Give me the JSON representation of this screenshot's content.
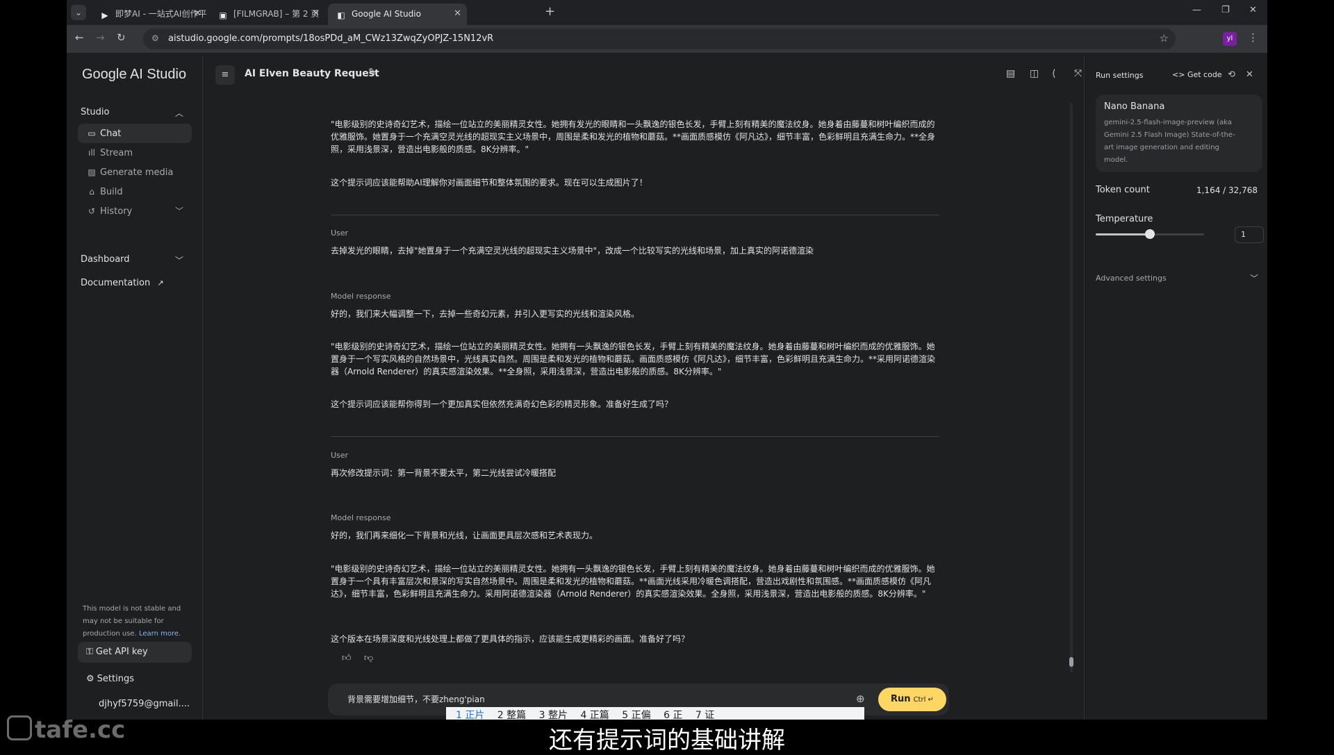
{
  "browser": {
    "tabs": [
      {
        "icon": "jimeng-icon",
        "title": "即梦AI - 一站式AI创作平台"
      },
      {
        "icon": "filmgrab-icon",
        "title": "[FILMGRAB] – 第 2 页"
      },
      {
        "icon": "ai-studio-icon",
        "title": "Google AI Studio"
      }
    ],
    "url": "aistudio.google.com/prompts/18osPDd_aM_CWz13ZwqZyOPJZ-15N12vR",
    "extension_badge": "yl"
  },
  "sidebar": {
    "brand": "Google AI Studio",
    "studio_label": "Studio",
    "items": [
      {
        "label": "Chat",
        "icon": "chat-icon"
      },
      {
        "label": "Stream",
        "icon": "stream-icon"
      },
      {
        "label": "Generate media",
        "icon": "media-icon"
      },
      {
        "label": "Build",
        "icon": "build-icon"
      },
      {
        "label": "History",
        "icon": "history-icon"
      }
    ],
    "dashboard_label": "Dashboard",
    "documentation_label": "Documentation",
    "note": "This model is not stable and may not be suitable for production use.",
    "note_link": "Learn more.",
    "get_api_key": "Get API key",
    "settings": "Settings",
    "account": "djhyf5759@gmail...."
  },
  "header": {
    "title": "AI Elven Beauty Request"
  },
  "chat": {
    "p1": "\"电影级别的史诗奇幻艺术，描绘一位站立的美丽精灵女性。她拥有发光的眼睛和一头飘逸的银色长发，手臂上刻有精美的魔法纹身。她身着由藤蔓和树叶编织而成的优雅服饰。她置身于一个充满空灵光线的超现实主义场景中，周围是柔和发光的植物和蘑菇。**画面质感模仿《阿凡达》，细节丰富，色彩鲜明且充满生命力。**全身照，采用浅景深，营造出电影般的质感。8K分辨率。\"",
    "p2": "这个提示词应该能帮助AI理解你对画面细节和整体氛围的要求。现在可以生成图片了！",
    "user_label": "User",
    "u1": "去掉发光的眼睛，去掉\"她置身于一个充满空灵光线的超现实主义场景中\"，改成一个比较写实的光线和场景，加上真实的阿诺德渲染",
    "model_label": "Model response",
    "m1a": "好的，我们来大幅调整一下，去掉一些奇幻元素，并引入更写实的光线和渲染风格。",
    "m1b": "\"电影级别的史诗奇幻艺术，描绘一位站立的美丽精灵女性。她拥有一头飘逸的银色长发，手臂上刻有精美的魔法纹身。她身着由藤蔓和树叶编织而成的优雅服饰。她置身于一个写实风格的自然场景中，光线真实自然。周围是柔和发光的植物和蘑菇。画面质感模仿《阿凡达》，细节丰富，色彩鲜明且充满生命力。**采用阿诺德渲染器（Arnold Renderer）的真实感渲染效果。**全身照，采用浅景深，营造出电影般的质感。8K分辨率。\"",
    "m1c": "这个提示词应该能帮你得到一个更加真实但依然充满奇幻色彩的精灵形象。准备好生成了吗？",
    "u2": "再次修改提示词：第一背景不要太平，第二光线尝试冷暖搭配",
    "m2a": "好的，我们再来细化一下背景和光线，让画面更具层次感和艺术表现力。",
    "m2b": "\"电影级别的史诗奇幻艺术，描绘一位站立的美丽精灵女性。她拥有一头飘逸的银色长发，手臂上刻有精美的魔法纹身。她身着由藤蔓和树叶编织而成的优雅服饰。她置身于一个具有丰富层次和景深的写实自然场景中。周围是柔和发光的植物和蘑菇。**画面光线采用冷暖色调搭配，营造出戏剧性和氛围感。**画面质感模仿《阿凡达》，细节丰富，色彩鲜明且充满生命力。采用阿诺德渲染器（Arnold Renderer）的真实感渲染效果。全身照，采用浅景深，营造出电影般的质感。8K分辨率。\"",
    "m2c": "这个版本在场景深度和光线处理上都做了更具体的指示，应该能生成更精彩的画面。准备好了吗？"
  },
  "composer": {
    "value": "背景需要增加细节，不要zheng'pian",
    "run_label": "Run",
    "run_shortcut": "Ctrl ↵",
    "ime_candidates": [
      "1 正片",
      "2 整篇",
      "3 整片",
      "4 正篇",
      "5 正偏",
      "6 正",
      "7 证"
    ]
  },
  "run_settings": {
    "title": "Run settings",
    "get_code": "Get code",
    "model_name": "Nano Banana",
    "model_desc": "gemini-2.5-flash-image-preview (aka Gemini 2.5 Flash Image) State-of-the-art image generation and editing model.",
    "token_label": "Token count",
    "token_value": "1,164 / 32,768",
    "temperature_label": "Temperature",
    "temperature_value": "1",
    "temperature_fraction": 0.5,
    "advanced_label": "Advanced settings"
  },
  "overlay": {
    "watermark": "tafe.cc",
    "subtitle": "还有提示词的基础讲解"
  }
}
